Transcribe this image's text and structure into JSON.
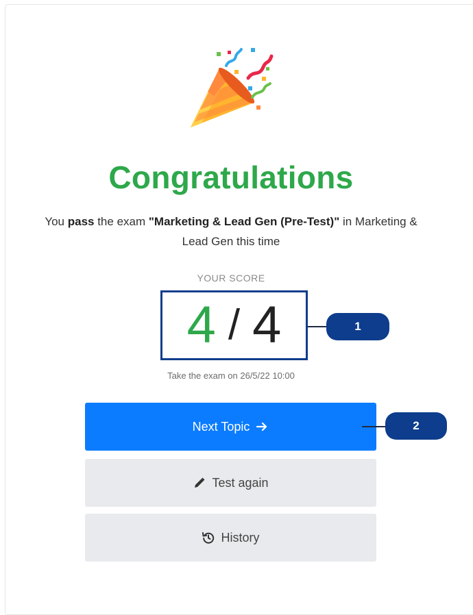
{
  "congrats": {
    "title": "Congratulations",
    "desc_prefix": "You ",
    "desc_pass": "pass",
    "desc_middle": " the exam ",
    "exam_name": "\"Marketing & Lead Gen (Pre-Test)\"",
    "desc_suffix": " in Marketing & Lead Gen this time"
  },
  "score": {
    "label": "YOUR SCORE",
    "got": "4",
    "separator": "/",
    "total": "4",
    "taken_text": "Take the exam on 26/5/22 10:00"
  },
  "buttons": {
    "next_topic": "Next Topic",
    "test_again": "Test again",
    "history": "History"
  },
  "callouts": {
    "one": "1",
    "two": "2"
  },
  "colors": {
    "success": "#2ea84a",
    "primary": "#0b7cff",
    "callout": "#0d3d8c",
    "secondary_bg": "#e9eaed"
  },
  "icons": {
    "hero": "party-popper-icon",
    "next": "arrow-right-icon",
    "test_again": "pencil-icon",
    "history": "history-icon"
  }
}
